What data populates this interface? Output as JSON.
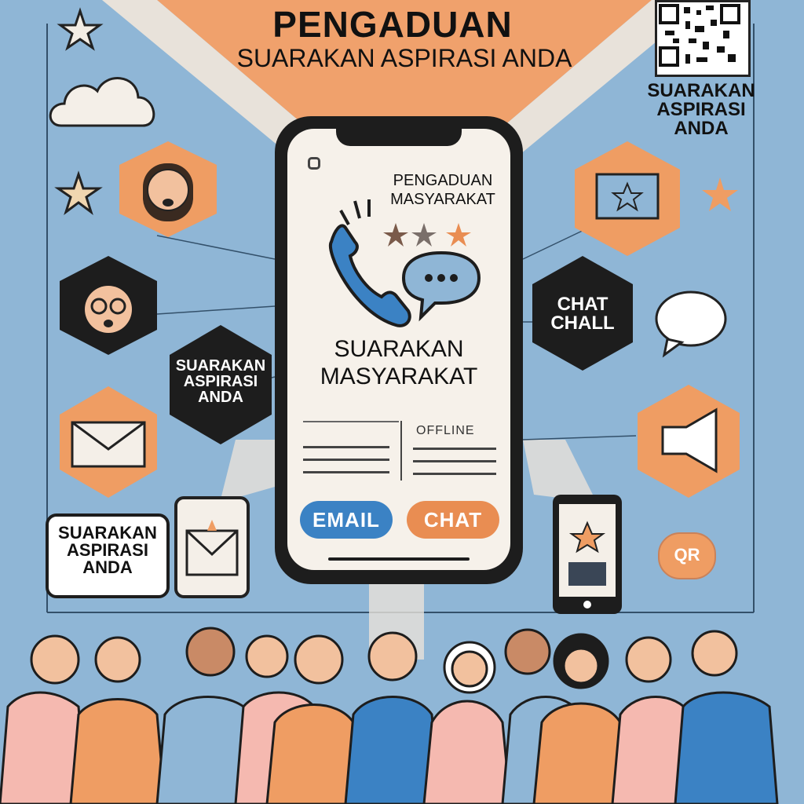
{
  "header": {
    "title": "PENGADUAN",
    "subtitle": "SUARAKAN ASPIRASI ANDA"
  },
  "qr_caption": "SUARAKAN ASPIRASI ANDA",
  "phone": {
    "header": "PENGADUAN MASYARAKAT",
    "headline": "SUARAKAN MASYARAKAT",
    "status": "OFFLINE",
    "email_button": "EMAIL",
    "chat_button": "CHAT"
  },
  "left_badge": "SUARAKAN ASPIRASI ANDA",
  "left_bubble": "SUARAKAN ASPIRASI ANDA",
  "right_badge": "CHAT CHALL",
  "qr_icon_label": "QR",
  "colors": {
    "background": "#8fb6d6",
    "orange": "#ef9d63",
    "dark": "#1d1d1d",
    "email_blue": "#3b82c4",
    "chat_orange": "#e98d52"
  },
  "icons": [
    "star-icon",
    "cloud-icon",
    "phone-icon",
    "chat-icon",
    "envelope-icon",
    "megaphone-icon",
    "qr-code-icon",
    "id-card-icon",
    "person-avatar-icon"
  ]
}
